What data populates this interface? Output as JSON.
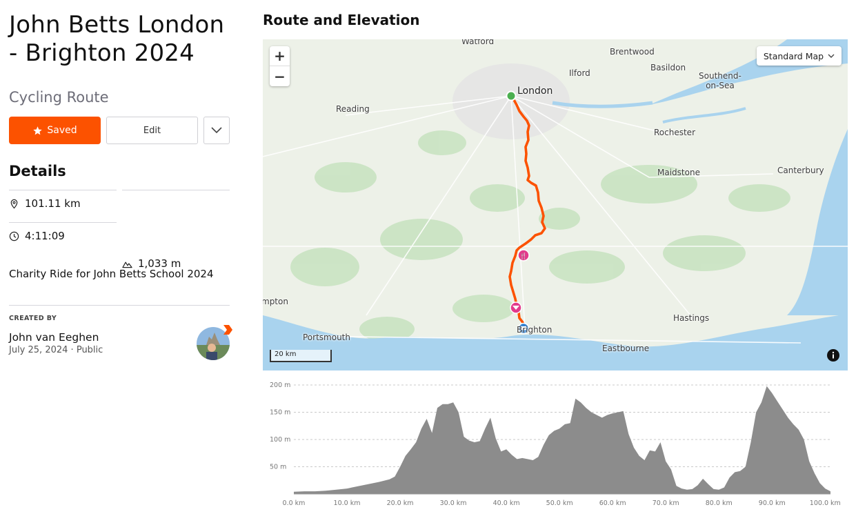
{
  "route": {
    "title": "John Betts London - Brighton 2024",
    "type": "Cycling Route",
    "saved_label": "Saved",
    "edit_label": "Edit",
    "details_heading": "Details",
    "distance": "101.11 km",
    "elevation_gain": "1,033 m",
    "time": "4:11:09",
    "description": "Charity Ride for John Betts School 2024",
    "created_by_label": "CREATED BY",
    "creator": "John van Eeghen",
    "date": "July 25, 2024",
    "separator": "·",
    "visibility": "Public"
  },
  "map": {
    "heading": "Route and Elevation",
    "style_label": "Standard Map",
    "zoom_in": "+",
    "zoom_out": "−",
    "scale_label": "20 km",
    "places": {
      "watford": "Watford",
      "brentwood": "Brentwood",
      "basildon": "Basildon",
      "ilford": "Ilford",
      "southend": "Southend-\non-Sea",
      "london": "London",
      "reading": "Reading",
      "rochester": "Rochester",
      "maidstone": "Maidstone",
      "canterbury": "Canterbury",
      "southampton": "mpton",
      "hastings": "Hastings",
      "portsmouth": "Portsmouth",
      "brighton": "Brighton",
      "eastbourne": "Eastbourne"
    },
    "route_color": "#fc5200",
    "start_color": "#4caf50"
  },
  "chart_data": {
    "type": "area",
    "xlabel": "",
    "ylabel": "",
    "x_ticks": [
      "0.0 km",
      "10.0 km",
      "20.0 km",
      "30.0 km",
      "40.0 km",
      "50.0 km",
      "60.0 km",
      "70.0 km",
      "80.0 km",
      "90.0 km",
      "100.0 km"
    ],
    "y_ticks": [
      "50 m",
      "100 m",
      "150 m",
      "200 m"
    ],
    "xlim": [
      0,
      101
    ],
    "ylim": [
      0,
      200
    ],
    "x": [
      0,
      2,
      4,
      6,
      8,
      10,
      12,
      14,
      16,
      18,
      19,
      20,
      21,
      22,
      23,
      24,
      25,
      26,
      27,
      28,
      29,
      30,
      31,
      32,
      33,
      34,
      35,
      36,
      37,
      38,
      39,
      40,
      41,
      42,
      43,
      44,
      45,
      46,
      47,
      48,
      49,
      50,
      51,
      52,
      53,
      54,
      55,
      56,
      57,
      58,
      59,
      60,
      61,
      62,
      63,
      64,
      65,
      66,
      67,
      68,
      69,
      70,
      71,
      72,
      73,
      74,
      75,
      76,
      77,
      78,
      79,
      80,
      81,
      82,
      83,
      84,
      85,
      86,
      87,
      88,
      89,
      90,
      91,
      92,
      93,
      94,
      95,
      96,
      97,
      98,
      99,
      100,
      101
    ],
    "y": [
      4,
      5,
      5,
      6,
      8,
      10,
      14,
      18,
      22,
      27,
      32,
      50,
      70,
      82,
      95,
      120,
      138,
      112,
      158,
      165,
      165,
      168,
      150,
      105,
      98,
      95,
      97,
      120,
      140,
      102,
      78,
      82,
      72,
      64,
      66,
      64,
      62,
      68,
      90,
      108,
      116,
      120,
      128,
      130,
      175,
      168,
      158,
      150,
      145,
      140,
      145,
      148,
      150,
      152,
      110,
      85,
      70,
      62,
      80,
      78,
      95,
      60,
      45,
      15,
      10,
      8,
      9,
      16,
      28,
      18,
      9,
      8,
      12,
      30,
      40,
      42,
      50,
      95,
      150,
      168,
      198,
      185,
      170,
      155,
      140,
      128,
      118,
      100,
      60,
      38,
      20,
      10,
      5
    ],
    "grid": true,
    "fill_color": "#8c8c8c"
  }
}
